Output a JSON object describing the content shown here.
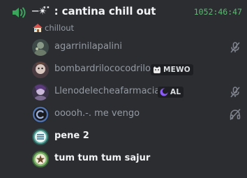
{
  "channel": {
    "name": "─✴̇ ̇ : cantina chill out",
    "timer": "1052:46:47",
    "status_text": "chillout"
  },
  "members": [
    {
      "name": "agarrinilapalini",
      "right_icon": "muted-mic-icon",
      "bright": false
    },
    {
      "name": "bombardrilococodrilo",
      "tag": "MEWO",
      "tag_icon": "cat-icon",
      "bright": false
    },
    {
      "name": "Llenodelecheafarmacia",
      "tag": "AL",
      "tag_icon": "moon-icon",
      "right_icon": "muted-mic-icon",
      "bright": false
    },
    {
      "name": "ooooh.-. me vengo",
      "right_icon": "deafened-icon",
      "bright": false
    },
    {
      "name": "pene 2",
      "bright": true
    },
    {
      "name": "tum tum tum sajur",
      "bright": true
    }
  ]
}
